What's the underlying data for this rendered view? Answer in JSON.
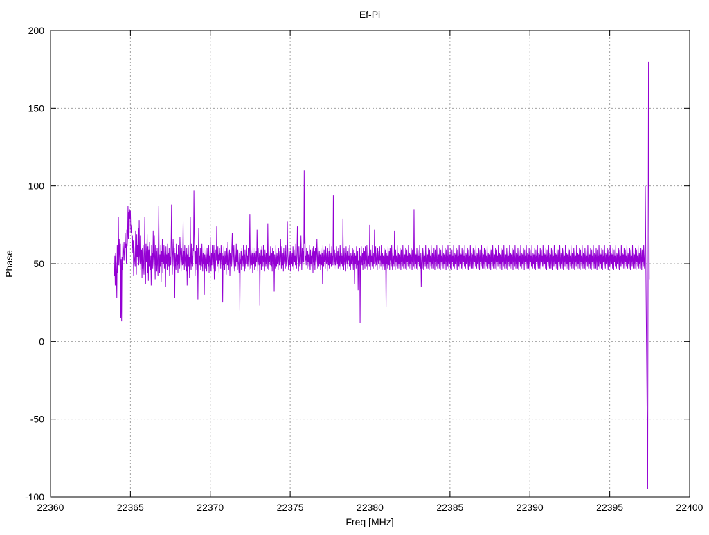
{
  "chart_data": {
    "type": "line",
    "title": "Ef-Pi",
    "xlabel": "Freq [MHz]",
    "ylabel": "Phase",
    "xlim": [
      22360,
      22400
    ],
    "ylim": [
      -100,
      200
    ],
    "x_ticks": [
      22360,
      22365,
      22370,
      22375,
      22380,
      22385,
      22390,
      22395,
      22400
    ],
    "y_ticks": [
      -100,
      -50,
      0,
      50,
      100,
      150,
      200
    ],
    "grid": true,
    "series": [
      {
        "color": "#9400d3",
        "x_start": 22364.0,
        "x_step": 0.025,
        "values": [
          42,
          55,
          36,
          57,
          51,
          44,
          28,
          62,
          44,
          63,
          80,
          49,
          66,
          57,
          48,
          63,
          15,
          53,
          13,
          54,
          46,
          63,
          52,
          58,
          64,
          52,
          53,
          70,
          60,
          63,
          50,
          72,
          61,
          68,
          87,
          66,
          83,
          70,
          85,
          79,
          84,
          72,
          70,
          75,
          60,
          68,
          57,
          65,
          42,
          61,
          55,
          51,
          48,
          71,
          56,
          43,
          69,
          54,
          62,
          52,
          73,
          49,
          78,
          55,
          50,
          68,
          46,
          55,
          59,
          41,
          60,
          47,
          62,
          50,
          43,
          58,
          80,
          53,
          37,
          63,
          51,
          55,
          69,
          44,
          61,
          39,
          59,
          48,
          64,
          50,
          46,
          55,
          36,
          62,
          52,
          57,
          47,
          71,
          55,
          48,
          68,
          54,
          40,
          62,
          49,
          58,
          45,
          60,
          50,
          42,
          64,
          87,
          53,
          44,
          56,
          48,
          62,
          38,
          58,
          51,
          66,
          44,
          55,
          50,
          62,
          47,
          53,
          59,
          35,
          61,
          50,
          56,
          46,
          63,
          52,
          57,
          48,
          60,
          42,
          55,
          53,
          49,
          65,
          88,
          51,
          43,
          57,
          66,
          54,
          48,
          60,
          28,
          57,
          51,
          46,
          63,
          52,
          49,
          56,
          44,
          62,
          50,
          55,
          47,
          67,
          58,
          52,
          45,
          60,
          54,
          49,
          56,
          77,
          50,
          58,
          46,
          62,
          53,
          48,
          57,
          45,
          60,
          36,
          56,
          50,
          62,
          48,
          54,
          41,
          57,
          80,
          52,
          46,
          63,
          50,
          55,
          48,
          60,
          58,
          97,
          70,
          54,
          42,
          58,
          50,
          62,
          46,
          55,
          60,
          27,
          57,
          73,
          51,
          55,
          49,
          60,
          46,
          55,
          48,
          63,
          52,
          45,
          57,
          50,
          61,
          30,
          56,
          52,
          47,
          59,
          51,
          45,
          60,
          50,
          56,
          48,
          62,
          44,
          55,
          51,
          67,
          50,
          45,
          57,
          49,
          62,
          55,
          47,
          53,
          62,
          40,
          57,
          50,
          45,
          59,
          52,
          74,
          55,
          48,
          61,
          50,
          56,
          44,
          60,
          52,
          57,
          47,
          62,
          54,
          49,
          57,
          25,
          55,
          49,
          61,
          52,
          46,
          58,
          50,
          55,
          43,
          60,
          52,
          49,
          64,
          51,
          46,
          56,
          59,
          42,
          57,
          50,
          55,
          48,
          61,
          70,
          52,
          47,
          56,
          62,
          50,
          45,
          57,
          53,
          48,
          63,
          51,
          55,
          46,
          59,
          52,
          49,
          44,
          57,
          20,
          53,
          50,
          58,
          46,
          60,
          52,
          55,
          48,
          62,
          50,
          56,
          45,
          59,
          51,
          47,
          57,
          62,
          50,
          55,
          48,
          60,
          53,
          46,
          58,
          82,
          51,
          47,
          59,
          54,
          49,
          57,
          44,
          61,
          52,
          50,
          57,
          46,
          60,
          53,
          48,
          58,
          51,
          72,
          54,
          45,
          60,
          52,
          49,
          57,
          23,
          55,
          50,
          59,
          46,
          61,
          52,
          55,
          48,
          62,
          51,
          56,
          45,
          59,
          53,
          48,
          57,
          50,
          55,
          47,
          76,
          52,
          46,
          58,
          51,
          55,
          49,
          61,
          54,
          48,
          57,
          45,
          60,
          52,
          50,
          58,
          32,
          56,
          51,
          47,
          62,
          53,
          48,
          57,
          50,
          55,
          46,
          60,
          53,
          49,
          58,
          51,
          66,
          54,
          47,
          61,
          52,
          49,
          57,
          45,
          60,
          53,
          50,
          58,
          47,
          62,
          52,
          48,
          57,
          77,
          55,
          51,
          46,
          60,
          54,
          49,
          58,
          45,
          62,
          52,
          50,
          57,
          48,
          61,
          53,
          46,
          59,
          51,
          55,
          49,
          63,
          52,
          47,
          58,
          74,
          54,
          50,
          45,
          61,
          52,
          48,
          57,
          50,
          68,
          55,
          46,
          60,
          53,
          49,
          58,
          51,
          110,
          63,
          70,
          52,
          55,
          49,
          60,
          53,
          47,
          58,
          51,
          56,
          48,
          62,
          52,
          46,
          59,
          50,
          55,
          48,
          60,
          57,
          44,
          61,
          52,
          49,
          58,
          46,
          60,
          53,
          50,
          57,
          66,
          52,
          47,
          61,
          53,
          48,
          58,
          50,
          56,
          46,
          60,
          53,
          49,
          57,
          37,
          62,
          52,
          48,
          59,
          51,
          55,
          47,
          61,
          53,
          50,
          57,
          45,
          60,
          52,
          49,
          58,
          47,
          63,
          53,
          50,
          57,
          48,
          61,
          52,
          55,
          49,
          94,
          55,
          47,
          59,
          52,
          49,
          57,
          46,
          61,
          53,
          50,
          58,
          47,
          60,
          52,
          55,
          48,
          62,
          52,
          46,
          57,
          50,
          55,
          48,
          79,
          54,
          46,
          60,
          52,
          49,
          57,
          45,
          61,
          53,
          50,
          58,
          47,
          60,
          52,
          55,
          48,
          62,
          51,
          46,
          57,
          50,
          55,
          48,
          60,
          53,
          46,
          59,
          51,
          37,
          57,
          50,
          55,
          47,
          61,
          53,
          49,
          58,
          33,
          52,
          46,
          57,
          60,
          12,
          55,
          48,
          61,
          52,
          49,
          57,
          46,
          60,
          53,
          50,
          58,
          47,
          61,
          52,
          55,
          48,
          62,
          51,
          46,
          57,
          50,
          55,
          48,
          75,
          53,
          46,
          59,
          51,
          55,
          48,
          62,
          52,
          47,
          57,
          50,
          72,
          55,
          48,
          61,
          52,
          49,
          57,
          46,
          60,
          53,
          50,
          58,
          47,
          61,
          52,
          55,
          48,
          62,
          51,
          46,
          57,
          50,
          55,
          48,
          60,
          53,
          46,
          59,
          51,
          22,
          57,
          50,
          55,
          47,
          61,
          53,
          49,
          58,
          46,
          60,
          52,
          55,
          48,
          62,
          51,
          46,
          57,
          50,
          55,
          48,
          71,
          53,
          46,
          59,
          51,
          55,
          48,
          62,
          52,
          47,
          57,
          50,
          56,
          47,
          60,
          53,
          46,
          59,
          51,
          55,
          48,
          62,
          52,
          47,
          57,
          50,
          56,
          47,
          60,
          53,
          46,
          59,
          51,
          55,
          48,
          62,
          52,
          47,
          57,
          50,
          56,
          47,
          60,
          53,
          46,
          59,
          51,
          55,
          48,
          85,
          52,
          47,
          57,
          50,
          56,
          47,
          60,
          53,
          46,
          59,
          51,
          55,
          48,
          62,
          52,
          47,
          57,
          35,
          50,
          56,
          47,
          60,
          53,
          46,
          59,
          51,
          55,
          48,
          62,
          52,
          47,
          57,
          50,
          56,
          47,
          60,
          53,
          46,
          59,
          51,
          55,
          48,
          62,
          52,
          47,
          57,
          50,
          56,
          47,
          60,
          53,
          46,
          59,
          51,
          55,
          48,
          62,
          52,
          47,
          57,
          50,
          56,
          47,
          60,
          53,
          46,
          59,
          51,
          55,
          48,
          62,
          52,
          47,
          57,
          50,
          56,
          47,
          60,
          53,
          46,
          59,
          51,
          55,
          48,
          62,
          52,
          47,
          57,
          50,
          56,
          47,
          60,
          53,
          46,
          59,
          51,
          55,
          48,
          62,
          52,
          47,
          57,
          50,
          56,
          47,
          60,
          53,
          46,
          59,
          51,
          55,
          48,
          62,
          52,
          47,
          57,
          50,
          56,
          47,
          60,
          53,
          46,
          59,
          51,
          55,
          48,
          62,
          52,
          47,
          57,
          50,
          56,
          47,
          60,
          53,
          46,
          59,
          51,
          55,
          48,
          62,
          52,
          47,
          57,
          50,
          56,
          47,
          60,
          53,
          46,
          59,
          51,
          55,
          48,
          62,
          52,
          47,
          57,
          50,
          56,
          47,
          60,
          53,
          46,
          59,
          51,
          55,
          48,
          62,
          52,
          47,
          57,
          50,
          56,
          47,
          60,
          53,
          46,
          59,
          51,
          55,
          48,
          62,
          52,
          47,
          57,
          50,
          56,
          47,
          60,
          53,
          46,
          59,
          51,
          55,
          48,
          62,
          52,
          47,
          57,
          50,
          56,
          47,
          60,
          53,
          46,
          59,
          51,
          55,
          48,
          62,
          52,
          47,
          57,
          50,
          56,
          47,
          60,
          53,
          46,
          59,
          51,
          55,
          48,
          62,
          52,
          47,
          57,
          50,
          56,
          47,
          60,
          53,
          46,
          59,
          51,
          55,
          48,
          62,
          52,
          47,
          57,
          50,
          56,
          47,
          60,
          53,
          46,
          59,
          51,
          55,
          48,
          62,
          52,
          47,
          57,
          50,
          56,
          47,
          60,
          53,
          46,
          59,
          51,
          55,
          48,
          62,
          52,
          47,
          57,
          50,
          56,
          47,
          60,
          53,
          46,
          59,
          51,
          55,
          48,
          62,
          52,
          47,
          57,
          50,
          56,
          47,
          60,
          53,
          46,
          59,
          51,
          55,
          48,
          62,
          52,
          47,
          57,
          50,
          56,
          47,
          60,
          53,
          46,
          59,
          51,
          55,
          48,
          62,
          52,
          47,
          57,
          50,
          56,
          47,
          60,
          53,
          46,
          59,
          51,
          55,
          48,
          62,
          52,
          47,
          57,
          50,
          56,
          47,
          60,
          53,
          46,
          59,
          51,
          55,
          48,
          62,
          52,
          47,
          57,
          50,
          56,
          47,
          60,
          53,
          46,
          59,
          51,
          55,
          48,
          62,
          52,
          47,
          57,
          50,
          56,
          47,
          60,
          53,
          46,
          59,
          51,
          55,
          48,
          62,
          52,
          47,
          57,
          50,
          56,
          47,
          60,
          53,
          46,
          59,
          51,
          55,
          48,
          62,
          52,
          47,
          57,
          50,
          56,
          47,
          60,
          53,
          46,
          59,
          51,
          55,
          48,
          62,
          52,
          47,
          57,
          50,
          56,
          47,
          60,
          53,
          46,
          59,
          51,
          55,
          48,
          62,
          52,
          47,
          57,
          50,
          56,
          47,
          60,
          53,
          46,
          59,
          51,
          55,
          48,
          62,
          52,
          47,
          57,
          50,
          56,
          47,
          60,
          53,
          46,
          59,
          51,
          55,
          48,
          62,
          52,
          47,
          57,
          50,
          56,
          47,
          60,
          53,
          46,
          59,
          51,
          55,
          48,
          62,
          52,
          47,
          57,
          50,
          56,
          47,
          60,
          53,
          46,
          59,
          51,
          55,
          48,
          62,
          52,
          47,
          57,
          50,
          56,
          47,
          60,
          53,
          46,
          59,
          51,
          55,
          48,
          62,
          52,
          47,
          57,
          50,
          56,
          47,
          60,
          53,
          46,
          59,
          51,
          55,
          48,
          62,
          52,
          47,
          57,
          50,
          56,
          47,
          60,
          53,
          46,
          59,
          51,
          55,
          48,
          62,
          52,
          47,
          57,
          50,
          56,
          47,
          60,
          53,
          46,
          59,
          51,
          55,
          48,
          62,
          52,
          47,
          57,
          50,
          56,
          47,
          60,
          53,
          46,
          59,
          51,
          55,
          48,
          62,
          52,
          47,
          57,
          50,
          56,
          47,
          60,
          53,
          46,
          59,
          51,
          55,
          48,
          62,
          52,
          47,
          57,
          50,
          56,
          47,
          60,
          53,
          46,
          59,
          51,
          55,
          48,
          62,
          52,
          47,
          57,
          50,
          56,
          47,
          60,
          53,
          46,
          59,
          51,
          55,
          48,
          62,
          52,
          47,
          57
        ]
      }
    ]
  }
}
